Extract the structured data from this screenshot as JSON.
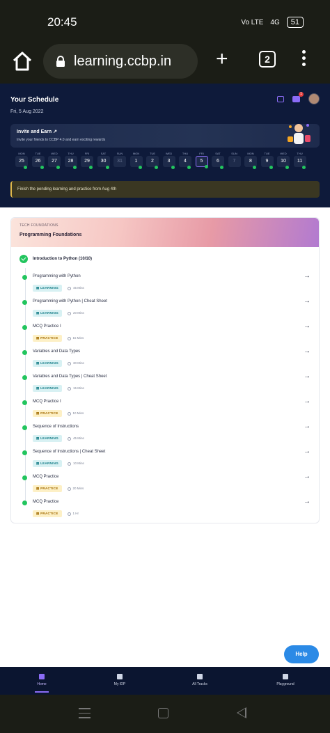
{
  "status_bar": {
    "time": "20:45",
    "network": "Vo LTE",
    "signal": "4G",
    "battery": "51"
  },
  "browser": {
    "url": "learning.ccbp.in",
    "tab_count": "2"
  },
  "schedule": {
    "title": "Your Schedule",
    "date": "Fri, 5 Aug 2022",
    "notification_count": "1",
    "invite": {
      "title": "Invite and Earn",
      "subtitle": "Invite your friends to CCBP 4.0 and earn exciting rewards"
    },
    "days": [
      {
        "name": "MON",
        "date": "25",
        "done": true
      },
      {
        "name": "TUE",
        "date": "26",
        "done": true
      },
      {
        "name": "WED",
        "date": "27",
        "done": true
      },
      {
        "name": "THU",
        "date": "28",
        "done": true
      },
      {
        "name": "FRI",
        "date": "29",
        "done": true
      },
      {
        "name": "SAT",
        "date": "30",
        "done": true
      },
      {
        "name": "SUN",
        "date": "31",
        "done": false
      },
      {
        "name": "MON",
        "date": "1",
        "done": true
      },
      {
        "name": "TUE",
        "date": "2",
        "done": true
      },
      {
        "name": "WED",
        "date": "3",
        "done": true
      },
      {
        "name": "THU",
        "date": "4",
        "done": true
      },
      {
        "name": "FRI",
        "date": "5",
        "done": true,
        "selected": true
      },
      {
        "name": "SAT",
        "date": "6",
        "done": true
      },
      {
        "name": "SUN",
        "date": "7",
        "done": false
      },
      {
        "name": "MON",
        "date": "8",
        "done": true
      },
      {
        "name": "TUE",
        "date": "9",
        "done": true
      },
      {
        "name": "WED",
        "date": "10",
        "done": true
      },
      {
        "name": "THU",
        "date": "11",
        "done": true
      }
    ],
    "pending_message": "Finish the pending learning and practice from Aug 4th"
  },
  "course_card": {
    "tag": "TECH FOUNDATIONS",
    "title": "Programming Foundations",
    "section": "Introduction to Python (10/10)",
    "items": [
      {
        "title": "Programming with Python",
        "type": "LEARNING",
        "duration": "45 Mins"
      },
      {
        "title": "Programming with Python | Cheat Sheet",
        "type": "LEARNING",
        "duration": "20 Mins"
      },
      {
        "title": "MCQ Practice I",
        "type": "PRACTICE",
        "duration": "15 Mins"
      },
      {
        "title": "Variables and Data Types",
        "type": "LEARNING",
        "duration": "30 Mins"
      },
      {
        "title": "Variables and Data Types | Cheat Sheet",
        "type": "LEARNING",
        "duration": "15 Mins"
      },
      {
        "title": "MCQ Practice I",
        "type": "PRACTICE",
        "duration": "10 Mins"
      },
      {
        "title": "Sequence of Instructions",
        "type": "LEARNING",
        "duration": "45 Mins"
      },
      {
        "title": "Sequence of Instructions | Cheat Sheet",
        "type": "LEARNING",
        "duration": "10 Mins"
      },
      {
        "title": "MCQ Practice",
        "type": "PRACTICE",
        "duration": "20 Mins"
      },
      {
        "title": "MCQ Practice",
        "type": "PRACTICE",
        "duration": "1 Hr"
      }
    ]
  },
  "help_label": "Help",
  "bottom_tabs": [
    {
      "label": "Home",
      "active": true
    },
    {
      "label": "My IDP",
      "active": false
    },
    {
      "label": "All Tracks",
      "active": false
    },
    {
      "label": "Playground",
      "active": false
    }
  ]
}
